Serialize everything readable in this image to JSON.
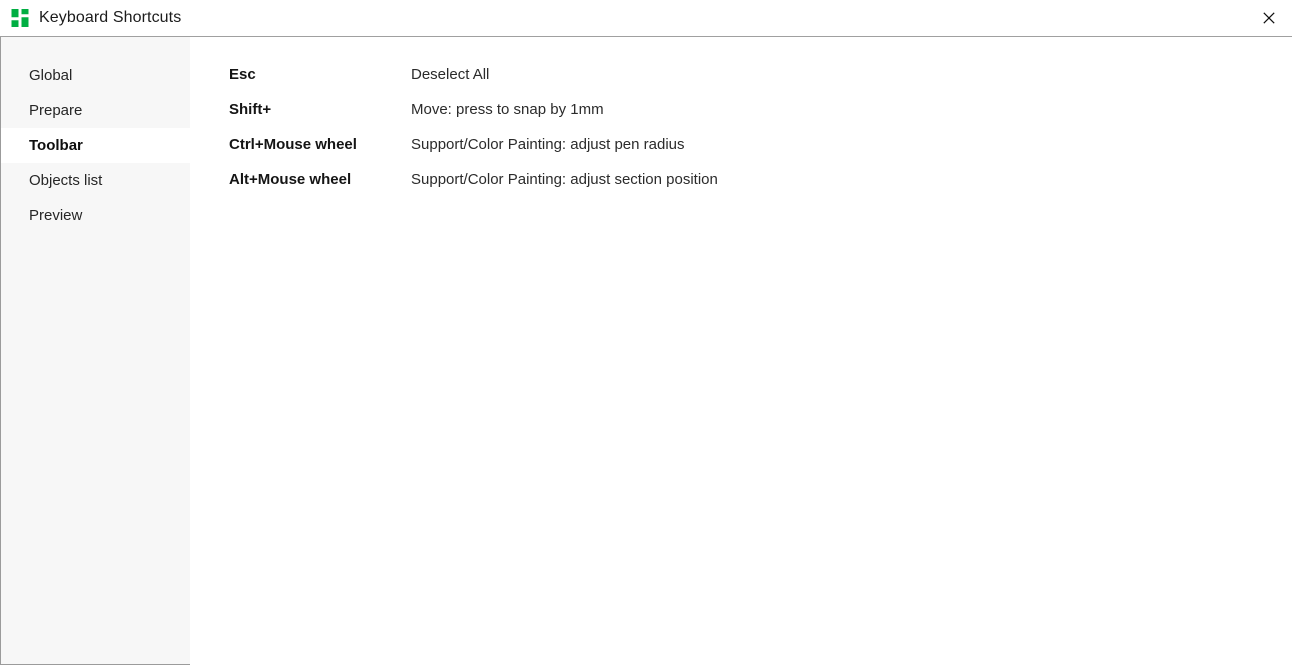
{
  "window": {
    "title": "Keyboard Shortcuts",
    "app_icon": "app-logo-icon",
    "close_label": "✕"
  },
  "sidebar": {
    "items": [
      {
        "label": "Global",
        "selected": false
      },
      {
        "label": "Prepare",
        "selected": false
      },
      {
        "label": "Toolbar",
        "selected": true
      },
      {
        "label": "Objects list",
        "selected": false
      },
      {
        "label": "Preview",
        "selected": false
      }
    ]
  },
  "content": {
    "shortcuts": [
      {
        "key": "Esc",
        "description": "Deselect All"
      },
      {
        "key": "Shift+",
        "description": "Move: press to snap by 1mm"
      },
      {
        "key": "Ctrl+Mouse wheel",
        "description": "Support/Color Painting: adjust pen radius"
      },
      {
        "key": "Alt+Mouse wheel",
        "description": "Support/Color Painting: adjust section position"
      }
    ]
  },
  "colors": {
    "accent_green": "#00AE42",
    "sidebar_bg": "#f7f7f7",
    "content_bg": "#ffffff",
    "text_primary": "#1c1c1c",
    "border": "#9b9b9b"
  }
}
